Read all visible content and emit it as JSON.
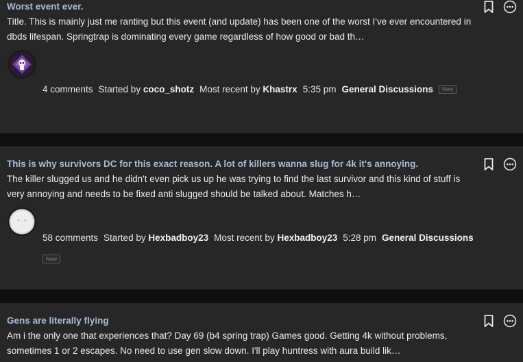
{
  "colors": {
    "title": "#a8bdd9",
    "card": "#272727",
    "gap": "#0f0f0f"
  },
  "icons": {
    "bookmark": "bookmark-icon",
    "more": "more-options-icon"
  },
  "posts": [
    {
      "title": "Worst event ever.",
      "excerpt": "Title. This is mainly just me ranting but this event (and update) has been one of the worst I've ever encountered in dbds lifespan. Springtrap is dominating every game regardless of how good or bad th…",
      "comments": "4 comments",
      "started_label": "Started by",
      "author": "coco_shotz",
      "recent_label": "Most recent by",
      "recent_author": "Khastrx",
      "time": "5:35 pm",
      "category": "General Discussions",
      "badge": "New"
    },
    {
      "title": "This is why survivors DC for this exact reason. A lot of killers wanna slug for 4k it's annoying.",
      "excerpt": "The killer slugged us and he didn't even pick us up he was trying to find the last survivor and this kind of stuff is very annoying and needs to be fixed anti slugged should be talked about. Matches h…",
      "comments": "58 comments",
      "started_label": "Started by",
      "author": "Hexbadboy23",
      "recent_label": "Most recent by",
      "recent_author": "Hexbadboy23",
      "time": "5:28 pm",
      "category": "General Discussions",
      "badge": "New"
    },
    {
      "title": "Gens are literally flying",
      "excerpt": "Am i the only one that experiences that? Day 69 (b4 spring trap) Games good. Getting 4k without problems, sometimes 1 or 2 escapes. No need to use gen slow down. I'll play huntress with aura build lik…"
    }
  ]
}
